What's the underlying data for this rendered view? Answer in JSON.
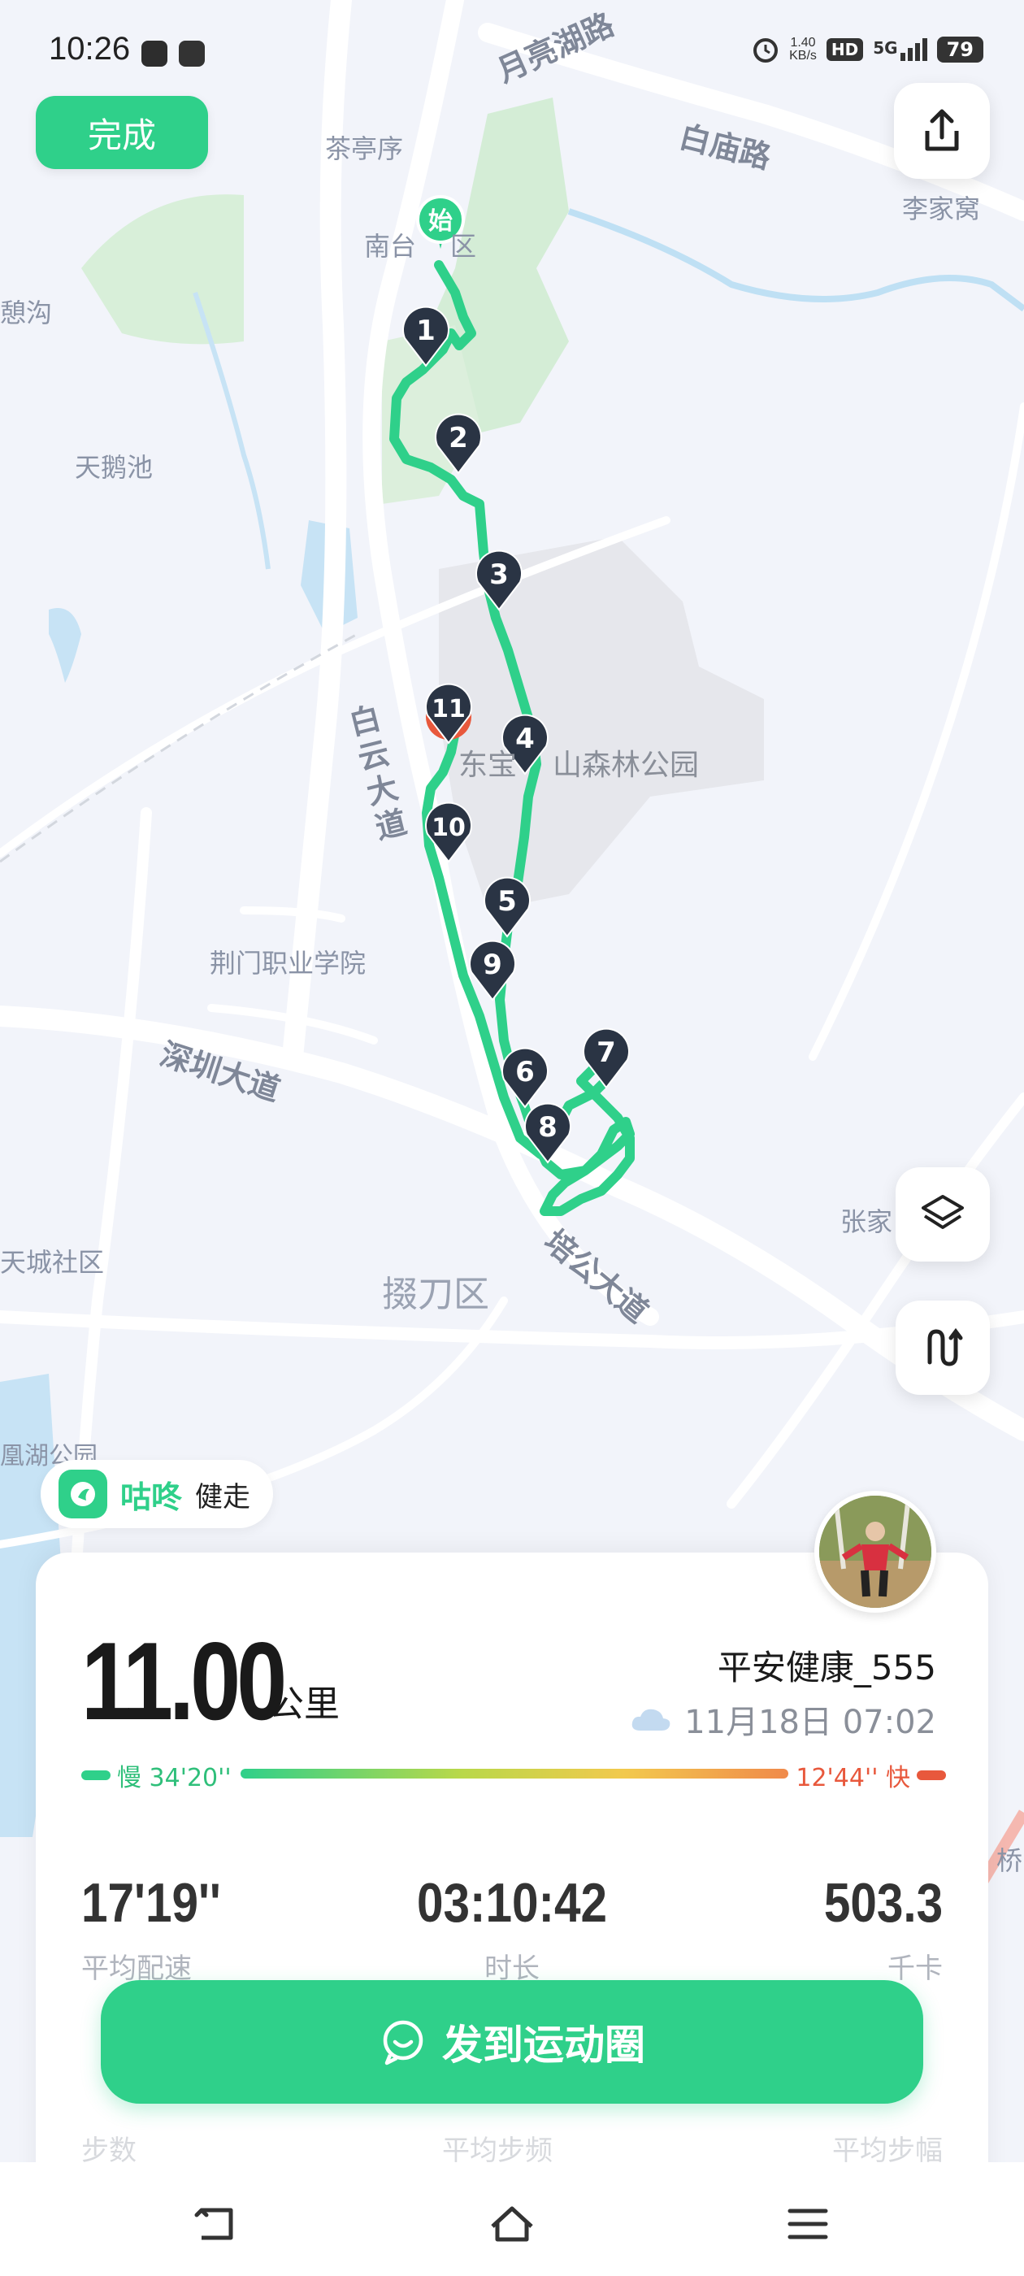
{
  "status_bar": {
    "time": "10:26",
    "net_speed_value": "1.40",
    "net_speed_unit": "KB/s",
    "hd": "HD",
    "network": "5G",
    "battery": "79"
  },
  "top": {
    "done_label": "完成",
    "share_icon": "share-icon"
  },
  "map": {
    "place_labels": [
      "月亮湖路",
      "白庙路",
      "茶亭序",
      "南台",
      "区",
      "李家窝",
      "憩沟",
      "天鹅池",
      "白云大道",
      "东宝",
      "山森林公园",
      "荆门职业学院",
      "深圳大道",
      "培公大道",
      "掇刀区",
      "天城社区",
      "张家",
      "凰湖公园",
      "桥"
    ],
    "start_label": "始",
    "km_markers": [
      "1",
      "2",
      "3",
      "4",
      "5",
      "6",
      "7",
      "8",
      "9",
      "10",
      "11"
    ],
    "route_color": "#2fd08a"
  },
  "tools": {
    "layers_icon": "layers-icon",
    "route_icon": "route-toggle-icon"
  },
  "brand": {
    "name": "咕咚",
    "mode": "健走"
  },
  "summary": {
    "distance": "11.00",
    "distance_unit": "公里",
    "username": "平安健康_555",
    "weather_icon": "cloud-icon",
    "datetime": "11月18日 07:02",
    "pace_slow_label": "慢 34'20''",
    "pace_fast_label": "12'44'' 快",
    "stats": [
      {
        "value": "17'19''",
        "label": "平均配速"
      },
      {
        "value": "03:10:42",
        "label": "时长"
      },
      {
        "value": "503.3",
        "label": "千卡"
      }
    ],
    "stats2_labels": [
      "步数",
      "平均步频",
      "平均步幅"
    ]
  },
  "share_button": {
    "label": "发到运动圈"
  },
  "colors": {
    "accent": "#2fd08a",
    "fast": "#e8583c"
  }
}
